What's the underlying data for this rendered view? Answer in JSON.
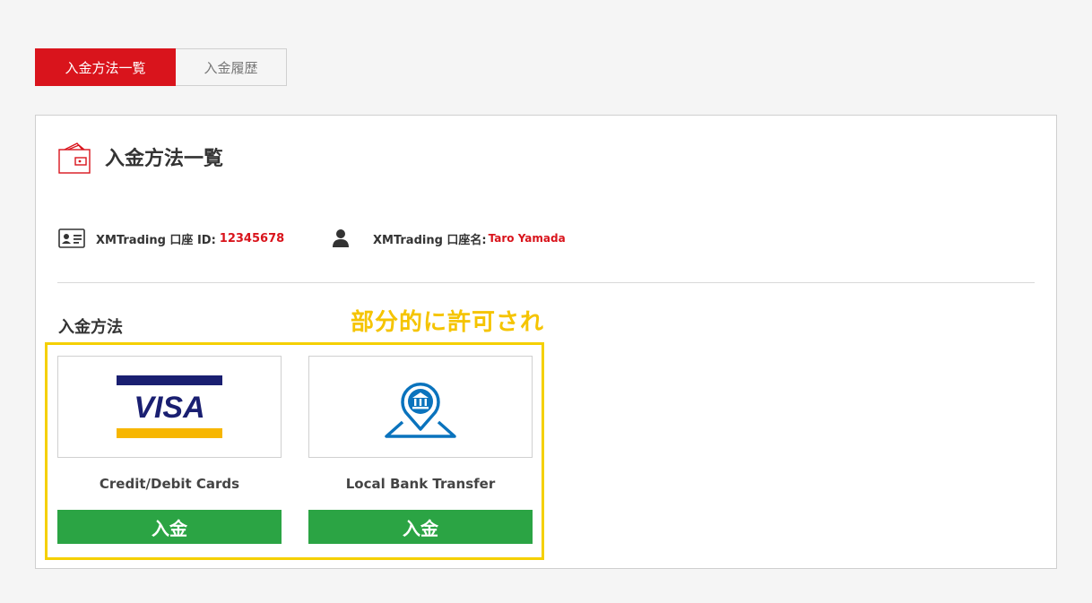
{
  "tabs": [
    {
      "label": "入金方法一覧",
      "active": true
    },
    {
      "label": "入金履歴",
      "active": false
    }
  ],
  "page": {
    "title": "入金方法一覧",
    "account_id_label": "XMTrading 口座 ID:",
    "account_id_value": "12345678",
    "account_name_label": "XMTrading 口座名:",
    "account_name_value": "Taro Yamada",
    "section_label": "入金方法",
    "annotation": "部分的に許可され"
  },
  "methods": [
    {
      "name": "Credit/Debit Cards",
      "logo_text": "VISA",
      "button": "入金"
    },
    {
      "name": "Local Bank Transfer",
      "button": "入金"
    }
  ],
  "colors": {
    "brand_red": "#d9141c",
    "button_green": "#2ba444",
    "annotation_yellow": "#f5c400",
    "visa_blue": "#1a1f71",
    "visa_gold": "#f7b600",
    "bank_blue": "#0a73bd"
  }
}
